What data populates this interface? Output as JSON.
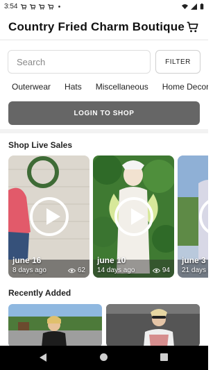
{
  "status_bar": {
    "time": "3:54"
  },
  "header": {
    "title": "Country Fried Charm Boutique"
  },
  "search": {
    "placeholder": "Search",
    "filter_label": "FILTER"
  },
  "categories": [
    "Outerwear",
    "Hats",
    "Miscellaneous",
    "Home Decor"
  ],
  "login": {
    "label": "LOGIN TO SHOP"
  },
  "live_section": {
    "title": "Shop Live Sales",
    "cards": [
      {
        "title": "june 16",
        "age": "8 days ago",
        "views": "62"
      },
      {
        "title": "june 10",
        "age": "14 days ago",
        "views": "94"
      },
      {
        "title": "june 3",
        "age": "21 days ago",
        "views": ""
      }
    ]
  },
  "recent_section": {
    "title": "Recently Added"
  },
  "colors": {
    "accent": "#666666",
    "divider": "#f2f2f2"
  }
}
